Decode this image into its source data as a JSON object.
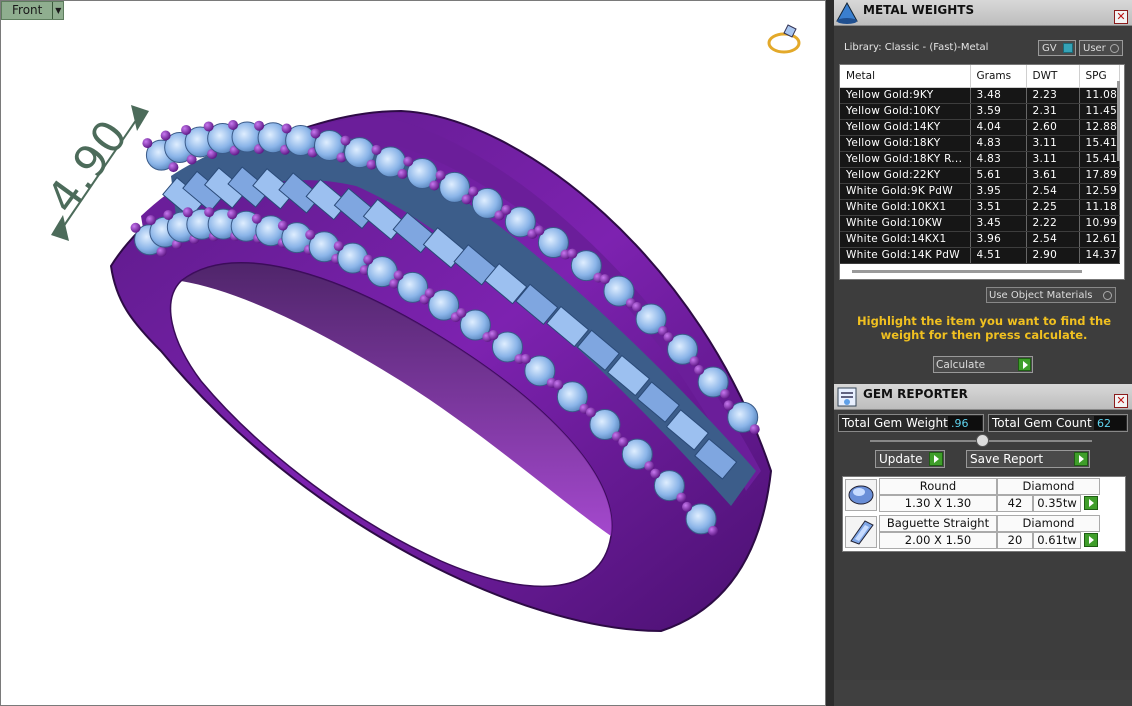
{
  "viewport": {
    "view_name": "Front",
    "dimension_label": "4.90"
  },
  "metal_weights": {
    "title": "METAL WEIGHTS",
    "library_label": "Library: Classic - (Fast)-Metal",
    "gv_label": "GV",
    "user_label": "User",
    "columns": [
      "Metal",
      "Grams",
      "DWT",
      "SPG"
    ],
    "rows": [
      [
        "Yellow Gold:9KY",
        "3.48",
        "2.23",
        "11.08"
      ],
      [
        "Yellow Gold:10KY",
        "3.59",
        "2.31",
        "11.45"
      ],
      [
        "Yellow Gold:14KY",
        "4.04",
        "2.60",
        "12.88"
      ],
      [
        "Yellow Gold:18KY",
        "4.83",
        "3.11",
        "15.41"
      ],
      [
        "Yellow Gold:18KY R...",
        "4.83",
        "3.11",
        "15.41"
      ],
      [
        "Yellow Gold:22KY",
        "5.61",
        "3.61",
        "17.89"
      ],
      [
        "White Gold:9K PdW",
        "3.95",
        "2.54",
        "12.59"
      ],
      [
        "White Gold:10KX1",
        "3.51",
        "2.25",
        "11.18"
      ],
      [
        "White Gold:10KW",
        "3.45",
        "2.22",
        "10.99"
      ],
      [
        "White Gold:14KX1",
        "3.96",
        "2.54",
        "12.61"
      ],
      [
        "White Gold:14K PdW",
        "4.51",
        "2.90",
        "14.37"
      ]
    ],
    "use_object_materials": "Use Object Materials",
    "hint": "Highlight the item you want to find the weight for then press calculate.",
    "calculate_label": "Calculate"
  },
  "gem_reporter": {
    "title": "GEM REPORTER",
    "total_weight_label": "Total Gem Weight",
    "total_weight_value": ".96",
    "total_count_label": "Total Gem Count",
    "total_count_value": "62",
    "update_label": "Update",
    "save_report_label": "Save Report",
    "gems": [
      {
        "shape": "Round",
        "material": "Diamond",
        "size": "1.30 X 1.30",
        "count": "42",
        "weight": "0.35tw"
      },
      {
        "shape": "Baguette Straight",
        "material": "Diamond",
        "size": "2.00 X 1.50",
        "count": "20",
        "weight": "0.61tw"
      }
    ]
  },
  "colors": {
    "ring_metal": "#7a1fa8",
    "gem_blue": "#8ab4e8",
    "hint_yellow": "#f0c020",
    "value_cyan": "#5fd3ee",
    "go_green": "#3f9e2a"
  }
}
